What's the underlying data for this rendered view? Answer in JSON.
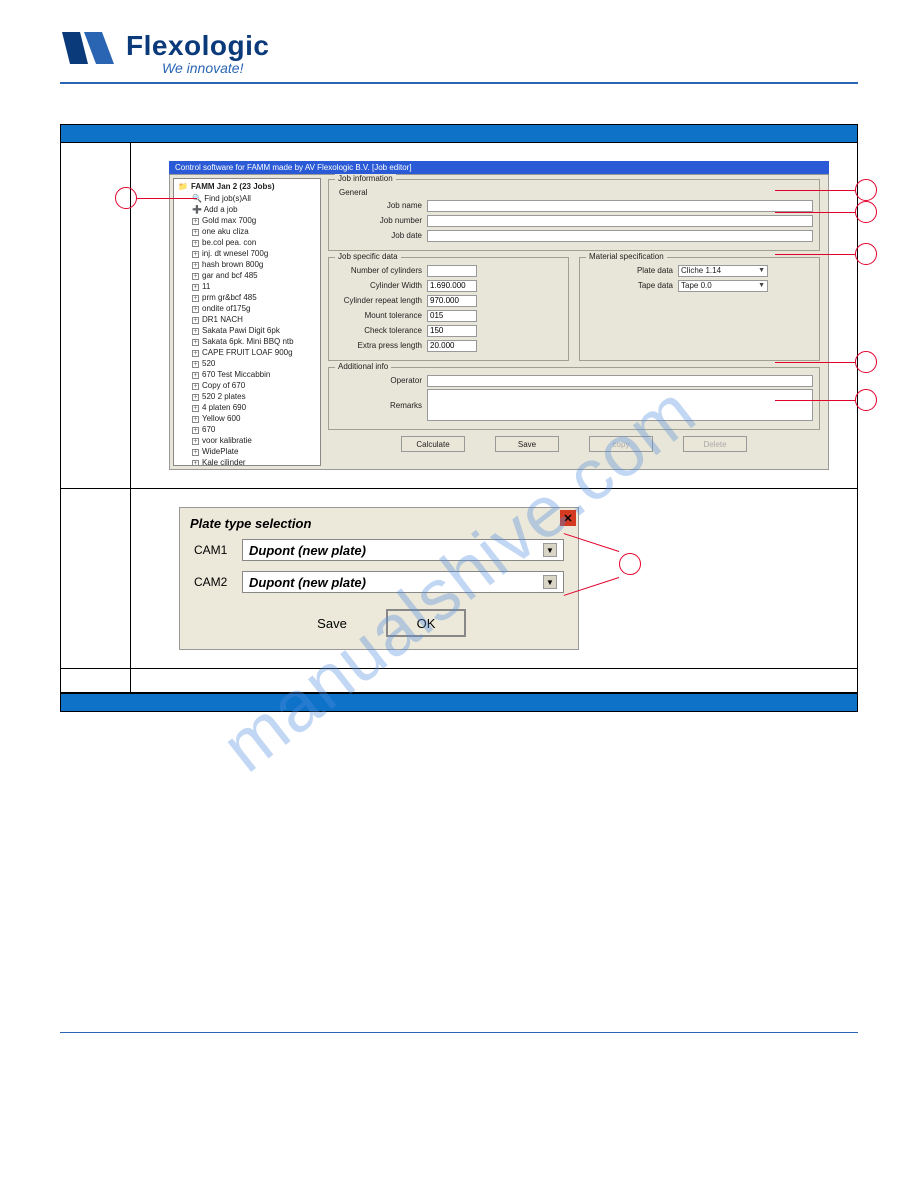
{
  "logo": {
    "brand": "Flexologic",
    "tagline": "We innovate!"
  },
  "watermark": "manualshive.com",
  "jobeditor": {
    "titlebar": "Control software for FAMM made by AV Flexologic B.V.   [Job editor]",
    "tree_header": "FAMM Jan 2 (23 Jobs)",
    "tree_find": "Find job(s)All",
    "tree_add": "Add a job",
    "tree_items": [
      "Gold max 700g",
      "one aku cliza",
      "be.col pea. con",
      "inj. dt wnesel 700g",
      "hash brown 800g",
      "gar and bcf 485",
      "11",
      "prm gr&bcf 485",
      "ondite of175g",
      "DR1 NACH",
      "Sakata Pawi Digit 6pk",
      "Sakata 6pk. Mini BBQ ntb",
      "CAPE FRUIT LOAF 900g",
      "520",
      "670 Test Miccabbin",
      "Copy of 670",
      "520 2 plates",
      "4 platen 690",
      "Yellow 600",
      "670",
      "voor kalibratie",
      "WidePlate",
      "Kale cilinder"
    ],
    "group_jobinfo": "Job information",
    "sub_general": "General",
    "lbl_jobname": "Job name",
    "lbl_jobnumber": "Job number",
    "lbl_jobdate": "Job date",
    "group_jobspec": "Job specific data",
    "lbl_numcyl": "Number of cylinders",
    "lbl_cylwidth": "Cylinder Width",
    "val_cylwidth": "1.690.000",
    "lbl_cylrep": "Cylinder repeat length",
    "val_cylrep": "970.000",
    "lbl_mounttol": "Mount tolerance",
    "val_mounttol": "015",
    "lbl_checktol": "Check tolerance",
    "val_checktol": "150",
    "lbl_extrapress": "Extra press length",
    "val_extrapress": "20.000",
    "group_matspec": "Material specification",
    "lbl_platedata": "Plate data",
    "val_platedata": "Cliche 1.14",
    "lbl_tapedata": "Tape data",
    "val_tapedata": "Tape 0.0",
    "group_addinfo": "Additional info",
    "lbl_operator": "Operator",
    "lbl_remarks": "Remarks",
    "btn_calculate": "Calculate",
    "btn_save": "Save",
    "btn_copy": "copy",
    "btn_delete": "Delete"
  },
  "pts": {
    "title": "Plate type selection",
    "cam1_label": "CAM1",
    "cam2_label": "CAM2",
    "option": "Dupont (new plate)",
    "save": "Save",
    "ok": "OK"
  }
}
